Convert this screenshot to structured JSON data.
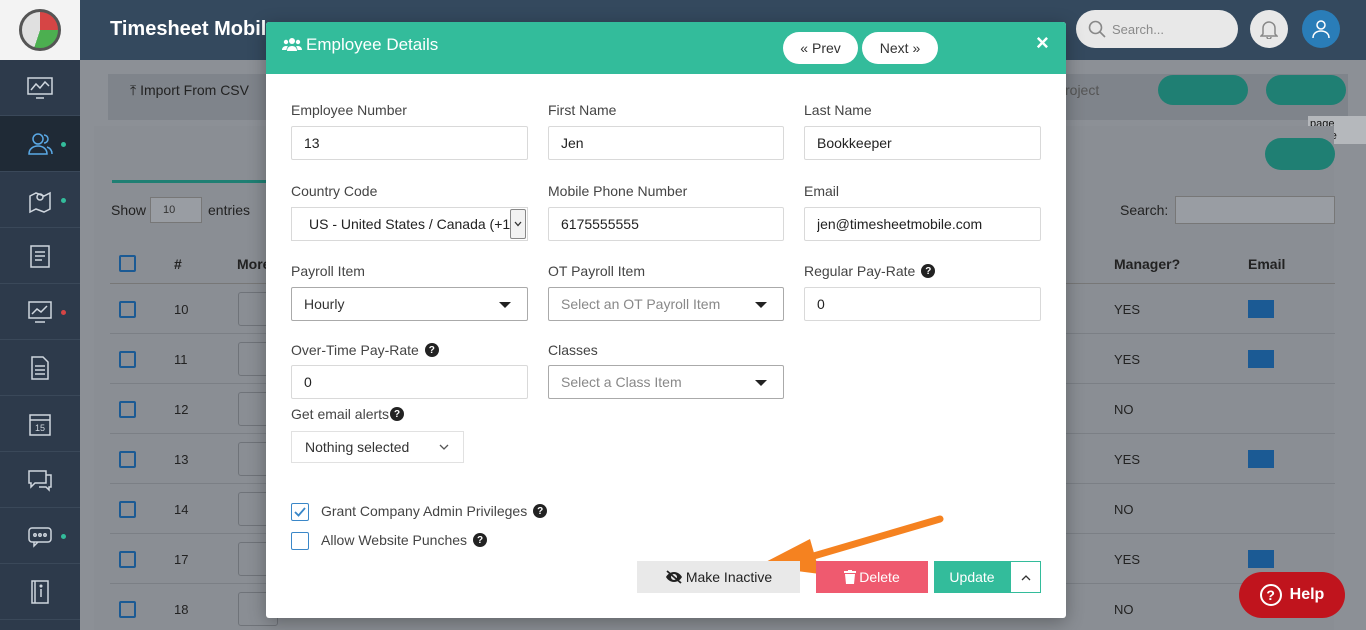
{
  "app": {
    "title": "Timesheet Mobile"
  },
  "header": {
    "search_placeholder": "Search..."
  },
  "background": {
    "import_label": "Import From CSV",
    "project_label": "roject",
    "page_guide": "page guide",
    "show_label": "Show",
    "entries_value": "10",
    "entries_label": "entries",
    "search_label": "Search:",
    "columns": {
      "num": "#",
      "more": "More",
      "manager": "Manager?",
      "email": "Email"
    },
    "rows": [
      {
        "num": "10",
        "manager": "YES",
        "email": true
      },
      {
        "num": "11",
        "manager": "YES",
        "email": true
      },
      {
        "num": "12",
        "manager": "NO",
        "email": false
      },
      {
        "num": "13",
        "manager": "YES",
        "email": true
      },
      {
        "num": "14",
        "manager": "NO",
        "email": false
      },
      {
        "num": "17",
        "manager": "YES",
        "email": true
      },
      {
        "num": "18",
        "manager": "NO",
        "email": false
      }
    ]
  },
  "modal": {
    "title": "Employee Details",
    "prev_label": "Prev",
    "next_label": "Next",
    "close_label": "×",
    "fields": {
      "employee_number": {
        "label": "Employee Number",
        "value": "13"
      },
      "first_name": {
        "label": "First Name",
        "value": "Jen"
      },
      "last_name": {
        "label": "Last Name",
        "value": "Bookkeeper"
      },
      "country_code": {
        "label": "Country Code",
        "value": "US - United States / Canada (+1"
      },
      "mobile_phone": {
        "label": "Mobile Phone Number",
        "value": "6175555555"
      },
      "email": {
        "label": "Email",
        "value": "jen@timesheetmobile.com"
      },
      "payroll_item": {
        "label": "Payroll Item",
        "value": "Hourly"
      },
      "ot_payroll_item": {
        "label": "OT Payroll Item",
        "placeholder": "Select an OT Payroll Item"
      },
      "regular_pay_rate": {
        "label": "Regular Pay-Rate",
        "value": "0"
      },
      "overtime_pay_rate": {
        "label": "Over-Time Pay-Rate",
        "value": "0"
      },
      "classes": {
        "label": "Classes",
        "placeholder": "Select a Class Item"
      },
      "email_alerts": {
        "label": "Get email alerts",
        "value": "Nothing selected"
      }
    },
    "checkboxes": {
      "admin": {
        "label": "Grant Company Admin Privileges",
        "checked": true
      },
      "website_punches": {
        "label": "Allow Website Punches",
        "checked": false
      }
    },
    "buttons": {
      "make_inactive": "Make Inactive",
      "delete": "Delete",
      "update": "Update"
    }
  },
  "help_button": {
    "label": "Help"
  },
  "colors": {
    "accent": "#33bc9b",
    "delete": "#ef5a6f",
    "sidebar": "#2d3a4b",
    "help": "#c0141d",
    "arrow": "#f58220"
  }
}
